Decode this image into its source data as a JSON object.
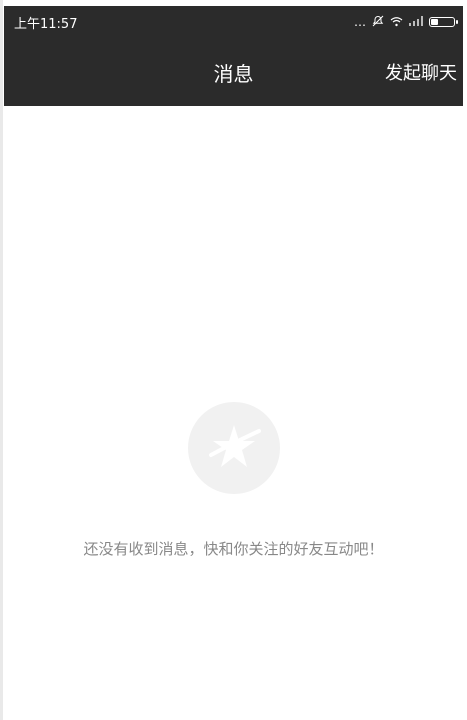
{
  "status_bar": {
    "time": "上午11:57",
    "icons": [
      "dots-icon",
      "mute-bell-icon",
      "wifi-icon",
      "signal-icon",
      "battery-icon"
    ]
  },
  "header": {
    "title": "消息",
    "action_label": "发起聊天"
  },
  "empty_state": {
    "icon": "star-icon",
    "text": "还没有收到消息，快和你关注的好友互动吧！"
  },
  "colors": {
    "header_bg": "#2b2b2b",
    "header_text": "#ffffff",
    "empty_text": "#888888",
    "empty_icon_bg": "#f1f1f1"
  }
}
